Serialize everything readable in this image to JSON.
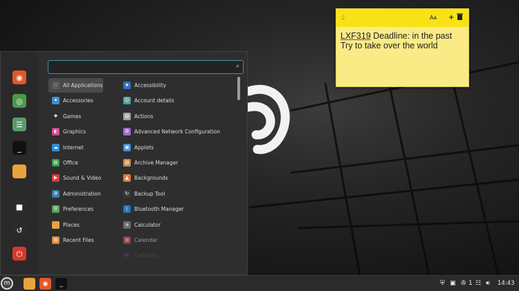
{
  "note": {
    "tag": "LXF319",
    "line1_rest": " Deadline: in the past",
    "line2": "Try to take over the world",
    "icons": [
      "drop-icon",
      "font-size-icon",
      "plus-icon",
      "trash-icon"
    ]
  },
  "menu": {
    "search": {
      "value": "",
      "placeholder": ""
    },
    "favorites": [
      {
        "name": "firefox-icon",
        "color": "#e0582a"
      },
      {
        "name": "software-manager-icon",
        "color": "#4a9a4a"
      },
      {
        "name": "settings-manager-icon",
        "color": "#5a9a6a"
      },
      {
        "name": "terminal-icon",
        "color": "#111111"
      },
      {
        "name": "files-folder-icon",
        "color": "#e8a33c"
      },
      {
        "name": "lock-screen-icon",
        "color": "#2b2b2b"
      },
      {
        "name": "logout-icon",
        "color": "#2b2b2b"
      },
      {
        "name": "power-icon",
        "color": "#d23a2a"
      }
    ],
    "categories": [
      {
        "label": "All Applications",
        "icon": "grid-icon",
        "color": "#5a5a5a"
      },
      {
        "label": "Accessories",
        "icon": "accessories-icon",
        "color": "#3a8fd0"
      },
      {
        "label": "Games",
        "icon": "gamepad-icon",
        "color": "#2e2e2e"
      },
      {
        "label": "Graphics",
        "icon": "graphics-icon",
        "color": "#d04a8a"
      },
      {
        "label": "Internet",
        "icon": "internet-icon",
        "color": "#2f8fd8"
      },
      {
        "label": "Office",
        "icon": "office-icon",
        "color": "#3a9a4a"
      },
      {
        "label": "Sound & Video",
        "icon": "sound-video-icon",
        "color": "#d83a3a"
      },
      {
        "label": "Administration",
        "icon": "administration-icon",
        "color": "#3a7ab0"
      },
      {
        "label": "Preferences",
        "icon": "preferences-icon",
        "color": "#5aa05a"
      },
      {
        "label": "Places",
        "icon": "folder-icon",
        "color": "#e8a33c"
      },
      {
        "label": "Recent Files",
        "icon": "recent-files-icon",
        "color": "#d88a3a"
      }
    ],
    "apps": [
      {
        "label": "Accessibility",
        "icon": "accessibility-icon",
        "color": "#2f6fc0"
      },
      {
        "label": "Account details",
        "icon": "account-details-icon",
        "color": "#4aa0a0"
      },
      {
        "label": "Actions",
        "icon": "actions-icon",
        "color": "#9aa0a8"
      },
      {
        "label": "Advanced Network Configuration",
        "icon": "network-config-icon",
        "color": "#a06ad0"
      },
      {
        "label": "Applets",
        "icon": "applets-icon",
        "color": "#3a8fd8"
      },
      {
        "label": "Archive Manager",
        "icon": "archive-manager-icon",
        "color": "#c88a4a"
      },
      {
        "label": "Backgrounds",
        "icon": "backgrounds-icon",
        "color": "#e07a3a"
      },
      {
        "label": "Backup Tool",
        "icon": "backup-tool-icon",
        "color": "#3a3a3a"
      },
      {
        "label": "Bluetooth Manager",
        "icon": "bluetooth-icon",
        "color": "#2f6fc0"
      },
      {
        "label": "Calculator",
        "icon": "calculator-icon",
        "color": "#6a6a6a"
      },
      {
        "label": "Calendar",
        "icon": "calendar-icon",
        "color": "#d04a4a"
      },
      {
        "label": "Celluloid",
        "icon": "celluloid-icon",
        "color": "#3a3a6a"
      }
    ]
  },
  "taskbar": {
    "pinned": [
      {
        "name": "mint-menu-icon",
        "color": "#555555"
      },
      {
        "name": "files-folder-icon",
        "color": "#e8a33c"
      },
      {
        "name": "firefox-icon",
        "color": "#e0582a"
      },
      {
        "name": "terminal-icon",
        "color": "#111111"
      }
    ],
    "notification_count": "1",
    "clock": "14:43"
  }
}
